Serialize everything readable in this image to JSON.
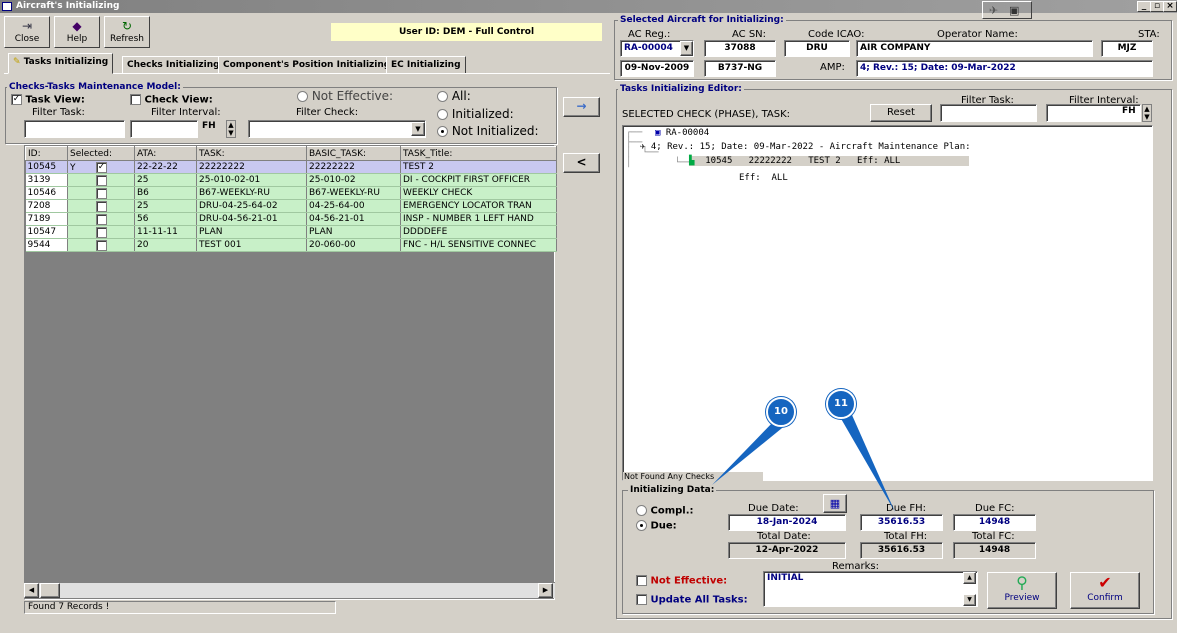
{
  "window": {
    "title": "Aircraft's Initializing"
  },
  "toolbar": {
    "close": "Close",
    "help": "Help",
    "refresh": "Refresh",
    "user": "User ID: DEM - Full Control"
  },
  "tabs": [
    "Tasks Initializing",
    "Checks Initializing",
    "Component's Position Initializing",
    "EC Initializing"
  ],
  "aircraft": {
    "group_title": "Selected Aircraft for Initializing:",
    "ac_reg_label": "AC Reg.:",
    "ac_reg": "RA-00004",
    "ac_sn_label": "AC SN:",
    "ac_sn": "37088",
    "icao_label": "Code ICAO:",
    "icao": "DRU",
    "operator_label": "Operator Name:",
    "operator": "AIR COMPANY",
    "sta_label": "STA:",
    "sta": "MJZ",
    "date": "09-Nov-2009",
    "model": "B737-NG",
    "amp_label": "AMP:",
    "amp": "4; Rev.: 15; Date: 09-Mar-2022"
  },
  "model": {
    "group_title": "Checks-Tasks Maintenance Model:",
    "task_view": "Task View:",
    "check_view": "Check View:",
    "filter_task": "Filter Task:",
    "filter_interval": "Filter Interval:",
    "filter_check": "Filter Check:",
    "unit": "FH",
    "not_effective": "Not Effective:",
    "all": "All:",
    "initialized": "Initialized:",
    "not_initialized": "Not Initialized:",
    "columns": [
      "ID:",
      "Selected:",
      "ATA:",
      "TASK:",
      "BASIC_TASK:",
      "TASK_Title:"
    ],
    "rows": [
      {
        "id": "10545",
        "sel": "Y",
        "checked": "✓",
        "ata": "22-22-22",
        "task": "22222222",
        "basic": "22222222",
        "title": "TEST 2"
      },
      {
        "id": "3139",
        "sel": "",
        "checked": "",
        "ata": "25",
        "task": "25-010-02-01",
        "basic": "25-010-02",
        "title": "DI - COCKPIT FIRST OFFICER"
      },
      {
        "id": "10546",
        "sel": "",
        "checked": "",
        "ata": "B6",
        "task": "B67-WEEKLY-RU",
        "basic": "B67-WEEKLY-RU",
        "title": "WEEKLY CHECK"
      },
      {
        "id": "7208",
        "sel": "",
        "checked": "",
        "ata": "25",
        "task": "DRU-04-25-64-02",
        "basic": "04-25-64-00",
        "title": "EMERGENCY LOCATOR TRAN"
      },
      {
        "id": "7189",
        "sel": "",
        "checked": "",
        "ata": "56",
        "task": "DRU-04-56-21-01",
        "basic": "04-56-21-01",
        "title": "INSP - NUMBER 1 LEFT HAND"
      },
      {
        "id": "10547",
        "sel": "",
        "checked": "",
        "ata": "11-11-11",
        "task": "PLAN",
        "basic": "PLAN",
        "title": "DDDDEFE"
      },
      {
        "id": "9544",
        "sel": "",
        "checked": "",
        "ata": "20",
        "task": "TEST 001",
        "basic": "20-060-00",
        "title": "FNC - H/L SENSITIVE CONNEC"
      }
    ],
    "status": "Found 7 Records !",
    "add_arrow": "→",
    "remove_arrow": "<"
  },
  "editor": {
    "group_title": "Tasks Initializing Editor:",
    "selected_label": "SELECTED CHECK (PHASE), TASK:",
    "reset": "Reset",
    "filter_task": "Filter Task:",
    "filter_interval": "Filter Interval:",
    "unit": "FH",
    "tree": [
      "RA-00004",
      "4; Rev.: 15; Date: 09-Mar-2022 - Aircraft Maintenance Plan:",
      "10545   22222222   TEST 2   Eff: ALL",
      "Eff:  ALL"
    ],
    "not_found": "Not Found Any Checks"
  },
  "init": {
    "group_title": "Initializing Data:",
    "compl": "Compl.:",
    "due": "Due:",
    "due_date_label": "Due Date:",
    "due_date": "18-Jan-2024",
    "due_fh_label": "Due FH:",
    "due_fh": "35616.53",
    "due_fc_label": "Due FC:",
    "due_fc": "14948",
    "total_date_label": "Total Date:",
    "total_date": "12-Apr-2022",
    "total_fh_label": "Total FH:",
    "total_fh": "35616.53",
    "total_fc_label": "Total FC:",
    "total_fc": "14948",
    "remarks_label": "Remarks:",
    "remarks": "INITIAL",
    "not_effective": "Not Effective:",
    "update_all": "Update All Tasks:",
    "preview": "Preview",
    "confirm": "Confirm"
  },
  "callouts": [
    "10",
    "11"
  ]
}
